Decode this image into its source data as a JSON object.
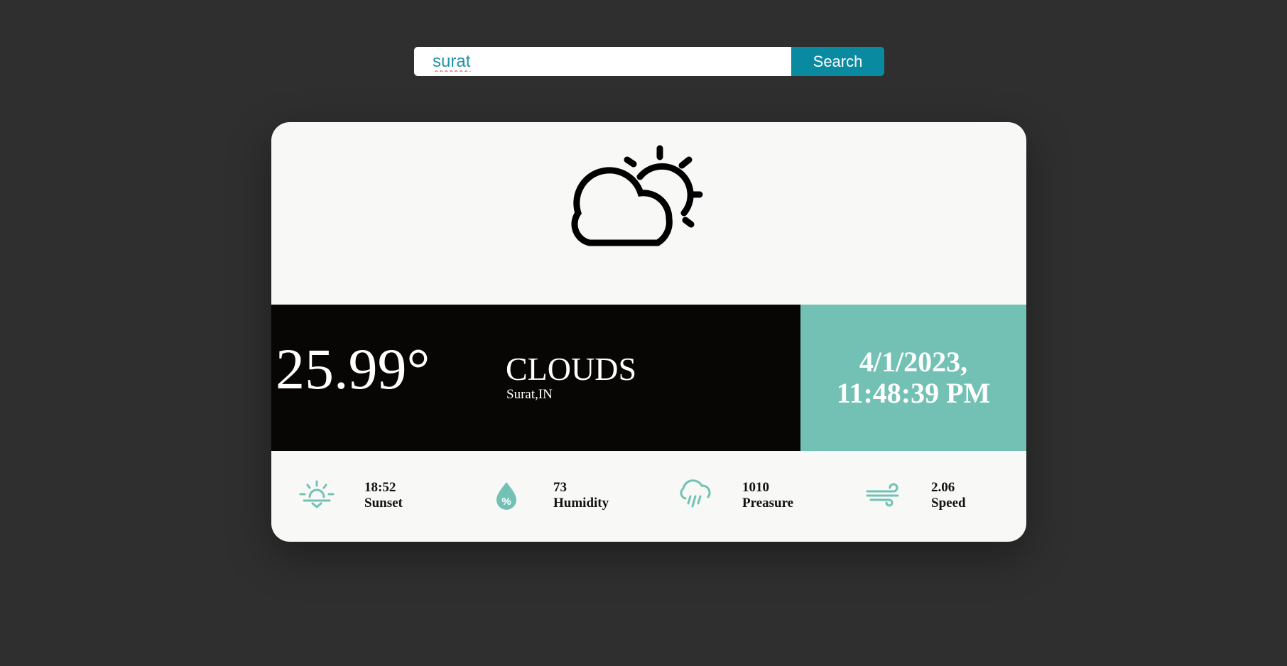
{
  "search": {
    "value": "surat",
    "button_label": "Search"
  },
  "weather": {
    "icon": "cloud-sun-icon",
    "temperature": "25.99°",
    "condition": "CLOUDS",
    "location": "Surat,IN",
    "date": "4/1/2023,",
    "time": "11:48:39 PM"
  },
  "stats": [
    {
      "icon": "sunset-icon",
      "value": "18:52",
      "label": "Sunset"
    },
    {
      "icon": "humidity-icon",
      "value": "73",
      "label": "Humidity"
    },
    {
      "icon": "rain-cloud-icon",
      "value": "1010",
      "label": "Preasure"
    },
    {
      "icon": "wind-icon",
      "value": "2.06",
      "label": "Speed"
    }
  ],
  "colors": {
    "background": "#2f2f2f",
    "accent_teal": "#72c1b4",
    "search_button": "#0a8aa0",
    "dark_band": "#070605",
    "card": "#f8f8f7"
  }
}
